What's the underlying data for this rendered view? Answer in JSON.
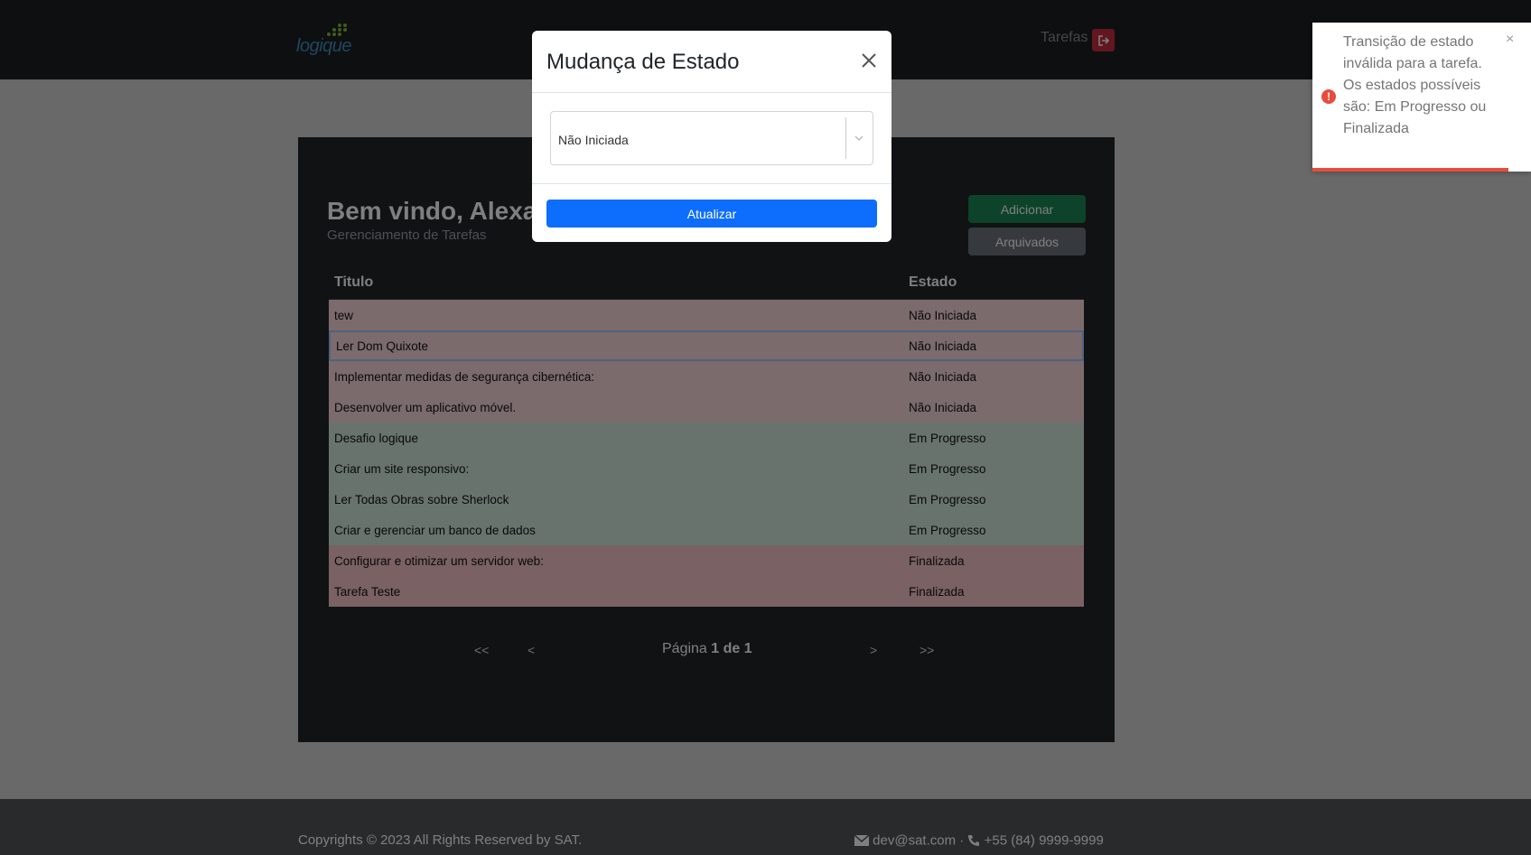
{
  "header": {
    "logo_text": "logique",
    "nav_label": "Tarefas",
    "logout_icon": "logout-icon"
  },
  "main": {
    "welcome": "Bem vindo, Alexa",
    "subtitle": "Gerenciamento de Tarefas",
    "add_label": "Adicionar",
    "archived_label": "Arquivados",
    "table": {
      "headers": [
        "Titulo",
        "Estado"
      ],
      "rows": [
        {
          "title": "tew",
          "state": "Não Iniciada"
        },
        {
          "title": "Ler Dom Quixote",
          "state": "Não Iniciada"
        },
        {
          "title": "Implementar medidas de segurança cibernética:",
          "state": "Não Iniciada"
        },
        {
          "title": "Desenvolver um aplicativo móvel.",
          "state": "Não Iniciada"
        },
        {
          "title": "Desafio logique",
          "state": "Em Progresso"
        },
        {
          "title": "Criar um site responsivo:",
          "state": "Em Progresso"
        },
        {
          "title": "Ler Todas Obras sobre Sherlock",
          "state": "Em Progresso"
        },
        {
          "title": "Criar e gerenciar um banco de dados",
          "state": "Em Progresso"
        },
        {
          "title": "Configurar e otimizar um servidor web:",
          "state": "Finalizada"
        },
        {
          "title": "Tarefa Teste",
          "state": "Finalizada"
        }
      ]
    },
    "pagination": {
      "first": "<<",
      "prev": "<",
      "next": ">",
      "last": ">>",
      "page_prefix": "Página",
      "page_current": "1 de 1"
    }
  },
  "modal": {
    "title": "Mudança de Estado",
    "select_value": "Não Iniciada",
    "update_label": "Atualizar"
  },
  "toast": {
    "message": "Transição de estado inválida para a tarefa. Os estados possíveis são: Em Progresso ou Finalizada",
    "close": "×",
    "icon": "!",
    "color": "#e74c3c"
  },
  "footer": {
    "copyright": "Copyrights © 2023 All Rights Reserved by SAT.",
    "email": "dev@sat.com",
    "separator": "·",
    "phone": "+55 (84) 9999-9999"
  },
  "colors": {
    "nao_iniciada": "#f7d7da",
    "em_progresso": "#d1e7dd",
    "finalizada": "#f5c2c7",
    "primary": "#0d6efd",
    "success": "#198754"
  }
}
